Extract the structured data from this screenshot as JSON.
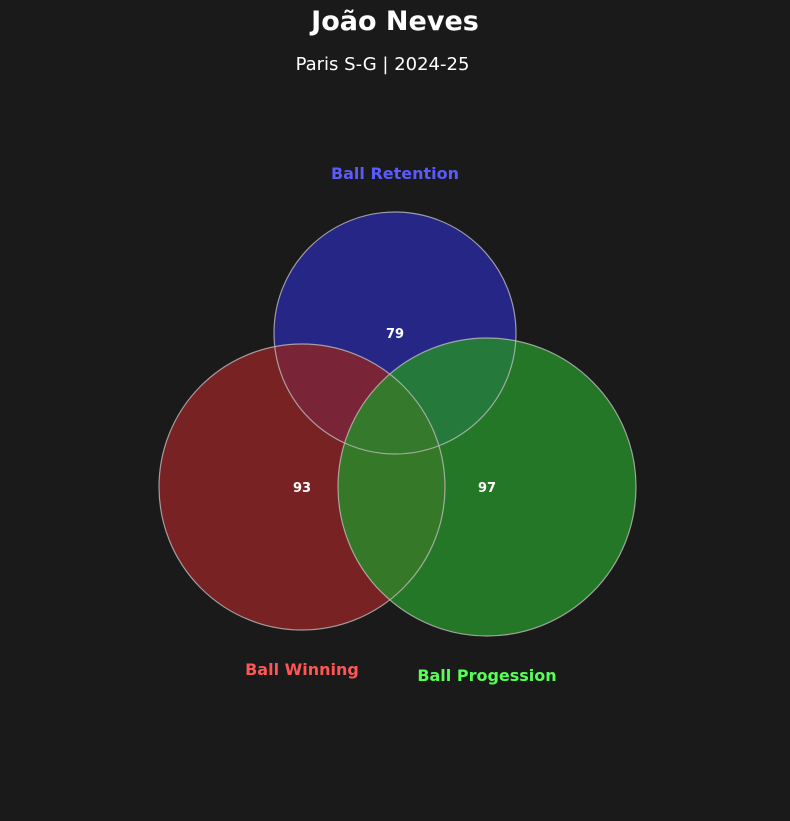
{
  "header": {
    "title": "João Neves",
    "subtitle": "Paris S-G | 2024-25"
  },
  "chart_data": {
    "type": "venn",
    "title": "João Neves",
    "subtitle": "Paris S-G | 2024-25",
    "sets": [
      {
        "name": "Ball Retention",
        "value": 79,
        "color": "#2a2aa0",
        "label_color": "#5a5aff"
      },
      {
        "name": "Ball Winning",
        "value": 93,
        "color": "#8e2526",
        "label_color": "#ff5555"
      },
      {
        "name": "Ball Progession",
        "value": 97,
        "color": "#268c29",
        "label_color": "#55ff55"
      }
    ],
    "background": "#1a1a1a",
    "outline_color": "#bbbbbb"
  }
}
